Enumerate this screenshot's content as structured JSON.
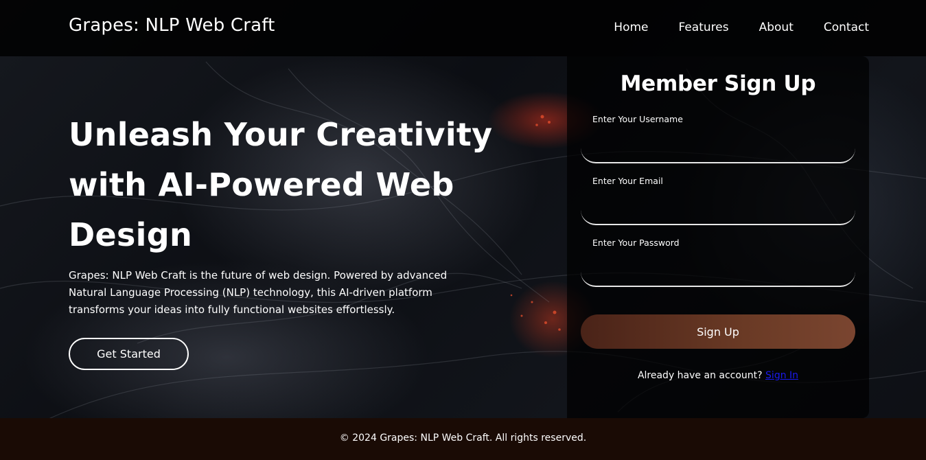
{
  "header": {
    "brand": "Grapes: NLP Web Craft",
    "nav": [
      {
        "label": "Home"
      },
      {
        "label": "Features"
      },
      {
        "label": "About"
      },
      {
        "label": "Contact"
      }
    ]
  },
  "hero": {
    "title": "Unleash Your Creativity with AI-Powered Web Design",
    "description": "Grapes: NLP Web Craft is the future of web design. Powered by advanced Natural Language Processing (NLP) technology, this AI-driven platform transforms your ideas into fully functional websites effortlessly.",
    "cta_label": "Get Started"
  },
  "signup": {
    "title": "Member Sign Up",
    "username_label": "Enter Your Username",
    "username_value": "",
    "email_label": "Enter Your Email",
    "email_value": "",
    "password_label": "Enter Your Password",
    "password_value": "",
    "button_label": "Sign Up",
    "account_text": "Already have an account?",
    "signin_link": "Sign In"
  },
  "footer": {
    "text": "© 2024 Grapes: NLP Web Craft. All rights reserved."
  },
  "colors": {
    "header_bg": "#000000",
    "footer_bg": "#1a0b05",
    "button_gradient_start": "#4a2318",
    "button_gradient_end": "#7a4530",
    "link": "#1a1aee",
    "accent_glow": "#d2321e"
  }
}
